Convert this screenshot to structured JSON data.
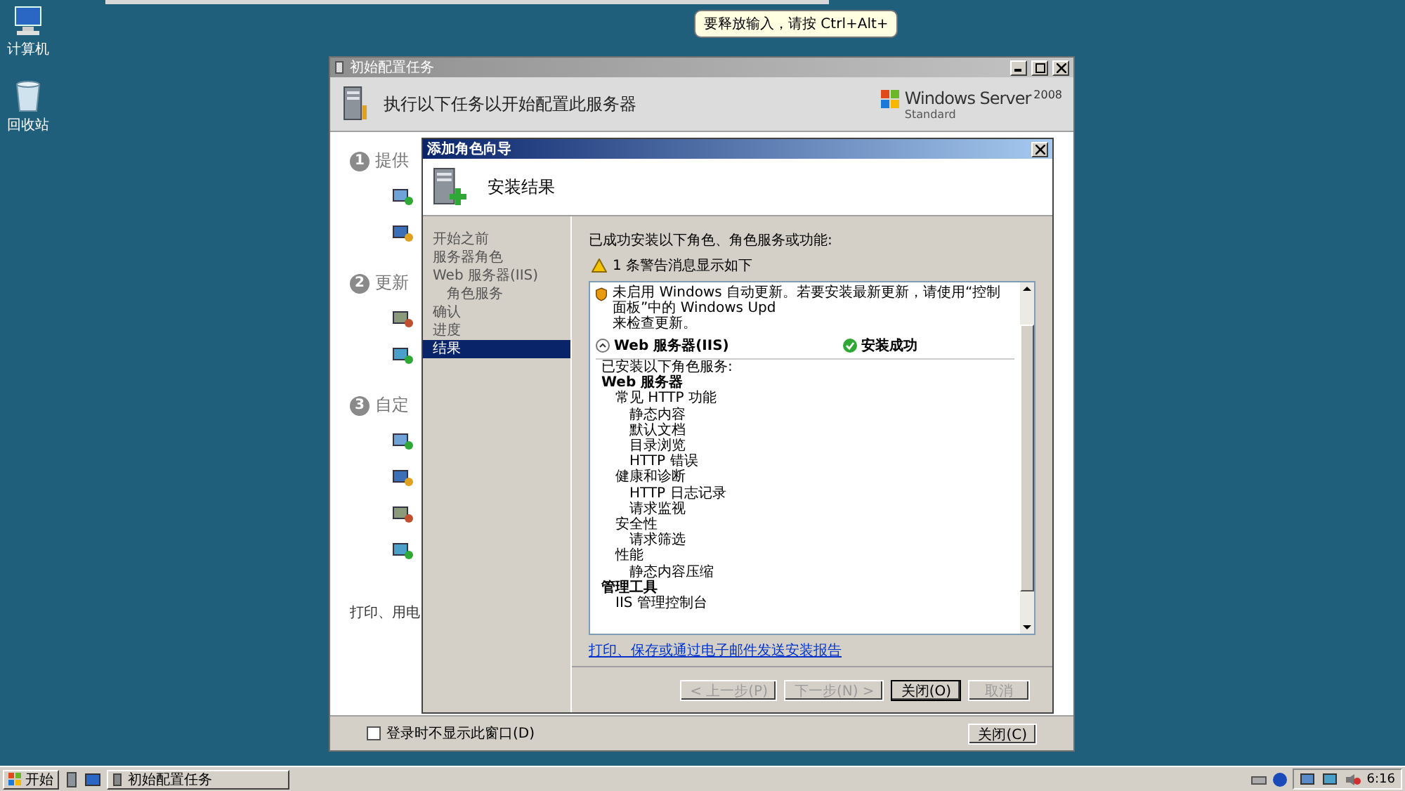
{
  "desktop_icons": [
    {
      "label": "计算机",
      "kind": "computer"
    },
    {
      "label": "回收站",
      "kind": "bin"
    }
  ],
  "tooltip": {
    "text": "要释放输入，请按 Ctrl+Alt+"
  },
  "main_window": {
    "title": "初始配置任务",
    "header": "执行以下任务以开始配置此服务器",
    "brand": {
      "name": "Windows Server",
      "version": "2008",
      "edition": "Standard"
    },
    "sections": [
      {
        "number": "1",
        "title": "提供"
      },
      {
        "number": "2",
        "title": "更新"
      },
      {
        "number": "3",
        "title": "自定"
      }
    ],
    "footer_text": "打印、用电",
    "checkbox": {
      "label": "登录时不显示此窗口(D)",
      "checked": false
    },
    "close_button": "关闭(C)"
  },
  "wizard": {
    "title": "添加角色向导",
    "heading": "安装结果",
    "steps": [
      {
        "label": "开始之前",
        "selected": false
      },
      {
        "label": "服务器角色",
        "selected": false
      },
      {
        "label": "Web 服务器(IIS)",
        "selected": false,
        "children": [
          {
            "label": "角色服务",
            "selected": false
          }
        ]
      },
      {
        "label": "确认",
        "selected": false
      },
      {
        "label": "进度",
        "selected": false
      },
      {
        "label": "结果",
        "selected": true
      }
    ],
    "summary": "已成功安装以下角色、角色服务或功能:",
    "warning_count": "1 条警告消息显示如下",
    "warning_lines": [
      "未启用 Windows 自动更新。若要安装最新更新，请使用“控制面板”中的 Windows Upd",
      "来检查更新。"
    ],
    "role": {
      "name": "Web 服务器(IIS)",
      "status": "安装成功",
      "expanded": true,
      "intro": "已安装以下角色服务:",
      "services": [
        {
          "label": "Web 服务器",
          "children": [
            {
              "label": "常见 HTTP 功能",
              "children": [
                {
                  "label": "静态内容"
                },
                {
                  "label": "默认文档"
                },
                {
                  "label": "目录浏览"
                },
                {
                  "label": "HTTP 错误"
                }
              ]
            },
            {
              "label": "健康和诊断",
              "children": [
                {
                  "label": "HTTP 日志记录"
                },
                {
                  "label": "请求监视"
                }
              ]
            },
            {
              "label": "安全性",
              "children": [
                {
                  "label": "请求筛选"
                }
              ]
            },
            {
              "label": "性能",
              "children": [
                {
                  "label": "静态内容压缩"
                }
              ]
            }
          ]
        },
        {
          "label": "管理工具",
          "children": [
            {
              "label": "IIS 管理控制台"
            }
          ]
        }
      ]
    },
    "link": "打印、保存或通过电子邮件发送安装报告",
    "buttons": [
      {
        "label": "< 上一步(P)",
        "disabled": true,
        "default": false
      },
      {
        "label": "下一步(N) >",
        "disabled": true,
        "default": false
      },
      {
        "label": "关闭(O)",
        "disabled": false,
        "default": true
      },
      {
        "label": "取消",
        "disabled": true,
        "default": false
      }
    ]
  },
  "taskbar": {
    "start": "开始",
    "tasks": [
      {
        "label": "初始配置任务",
        "selected": false
      }
    ],
    "clock": "6:16"
  }
}
